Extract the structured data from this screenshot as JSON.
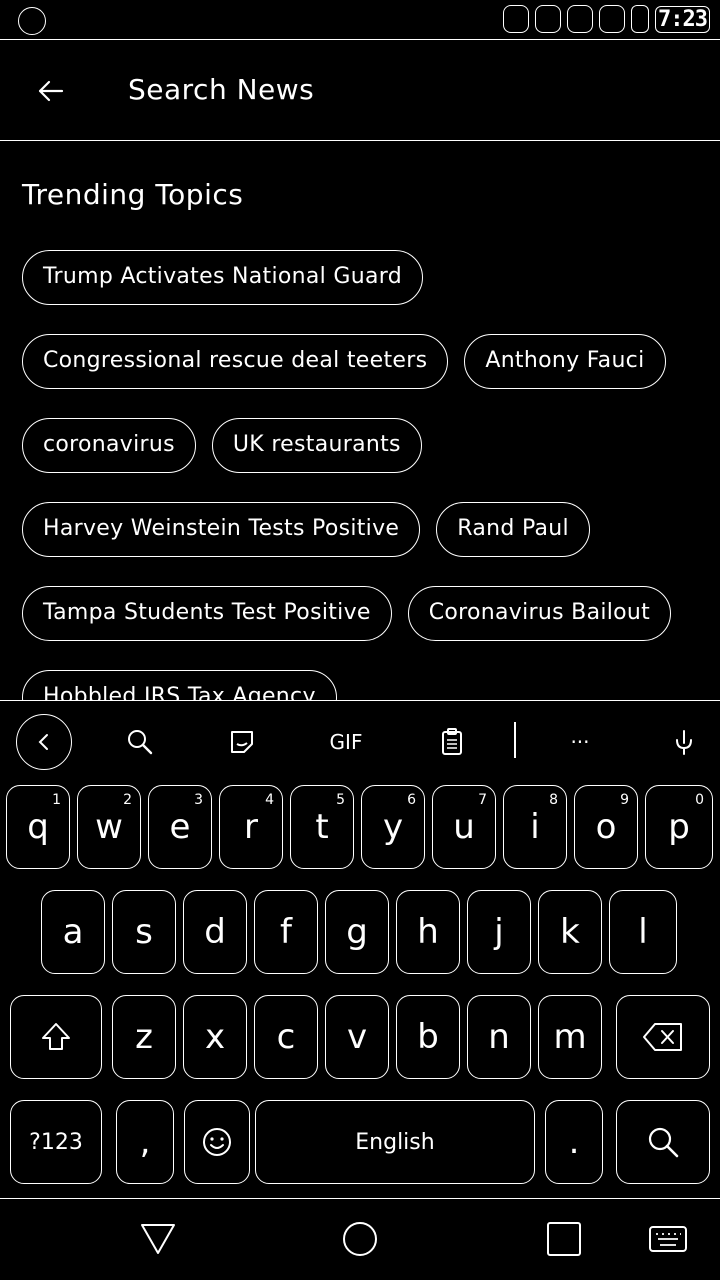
{
  "status_bar": {
    "time": "7:23"
  },
  "app_bar": {
    "title": "Search News"
  },
  "trending": {
    "title": "Trending Topics",
    "rows": [
      [
        "Trump Activates National Guard"
      ],
      [
        "Congressional rescue deal teeters",
        "Anthony Fauci"
      ],
      [
        "coronavirus",
        "UK restaurants"
      ],
      [
        "Harvey Weinstein Tests Positive",
        "Rand Paul"
      ],
      [
        "Tampa Students Test Positive",
        "Coronavirus Bailout"
      ],
      [
        "Hobbled IRS Tax Agency"
      ]
    ]
  },
  "keyboard": {
    "toolbar": {
      "gif_label": "GIF",
      "more_label": "···"
    },
    "row1": [
      {
        "key": "q",
        "hint": "1"
      },
      {
        "key": "w",
        "hint": "2"
      },
      {
        "key": "e",
        "hint": "3"
      },
      {
        "key": "r",
        "hint": "4"
      },
      {
        "key": "t",
        "hint": "5"
      },
      {
        "key": "y",
        "hint": "6"
      },
      {
        "key": "u",
        "hint": "7"
      },
      {
        "key": "i",
        "hint": "8"
      },
      {
        "key": "o",
        "hint": "9"
      },
      {
        "key": "p",
        "hint": "0"
      }
    ],
    "row2": [
      "a",
      "s",
      "d",
      "f",
      "g",
      "h",
      "j",
      "k",
      "l"
    ],
    "row3": [
      "z",
      "x",
      "c",
      "v",
      "b",
      "n",
      "m"
    ],
    "symbols_label": "?123",
    "comma_label": ",",
    "space_label": "English",
    "period_label": "."
  }
}
